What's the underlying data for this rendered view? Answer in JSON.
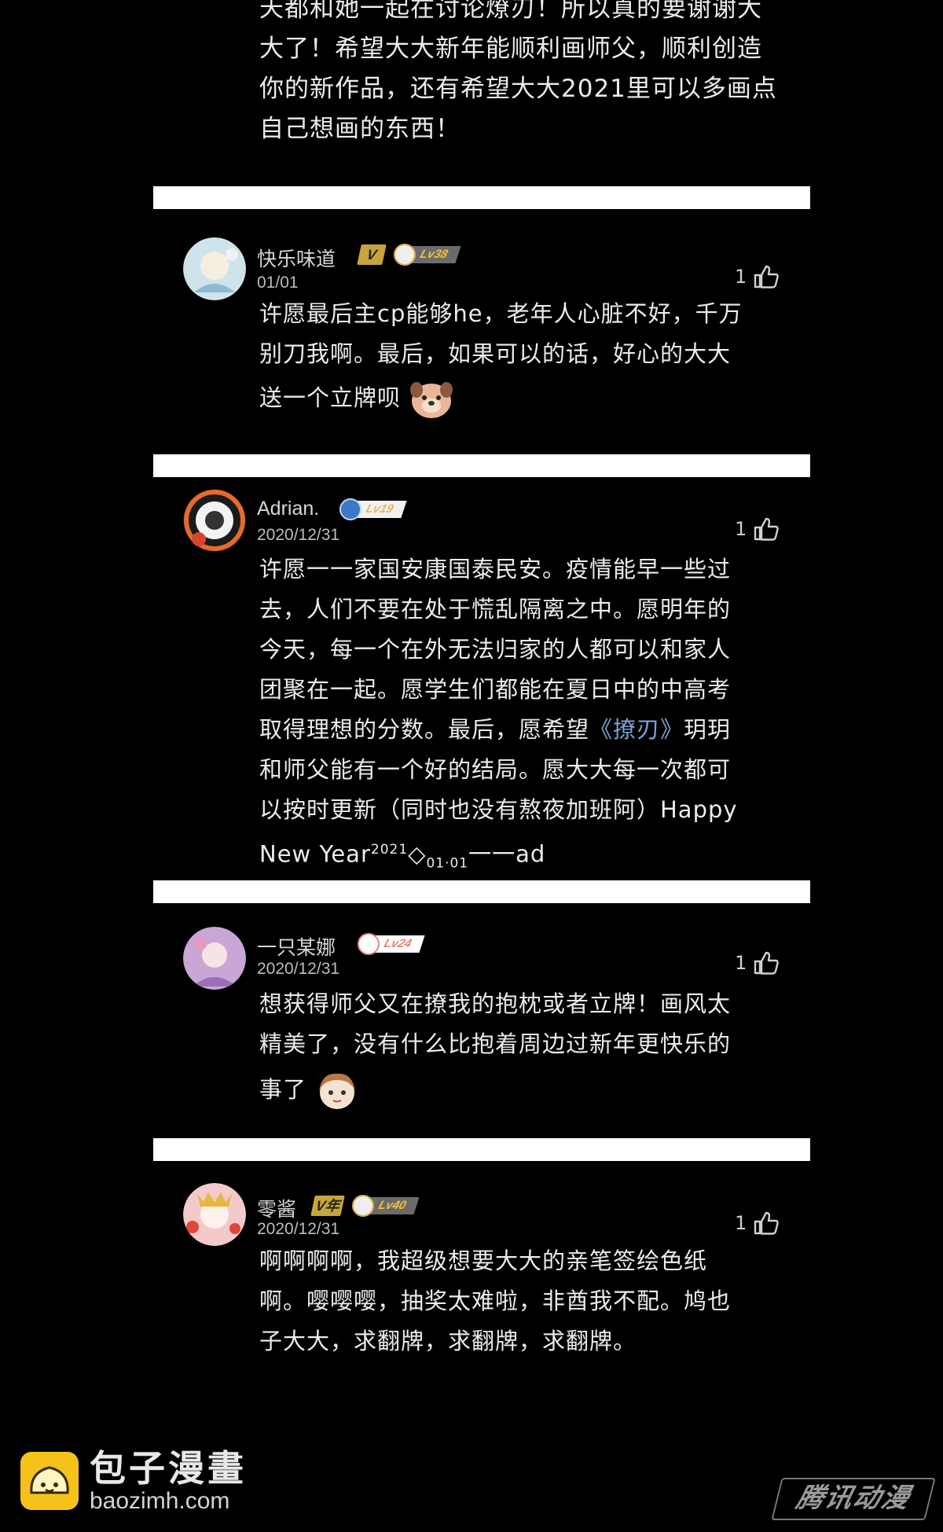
{
  "top_comment": {
    "lines": [
      "天都和她一起在讨论燎刃！所以真的要谢谢大",
      "大了！希望大大新年能顺利画师父，顺利创造",
      "你的新作品，还有希望大大2021里可以多画点",
      "自己想画的东西！"
    ]
  },
  "comments": [
    {
      "username": "快乐味道",
      "vip_badge": "V",
      "level": "Lv38",
      "date": "01/01",
      "likes": "1",
      "lines": [
        "许愿最后主cp能够he，老年人心脏不好，千万",
        "别刀我啊。最后，如果可以的话，好心的大大",
        "送一个立牌呗"
      ]
    },
    {
      "username": "Adrian.",
      "level": "Lv19",
      "date": "2020/12/31",
      "likes": "1",
      "lines": [
        "许愿一一家国安康国泰民安。疫情能早一些过",
        "去，人们不要在处于慌乱隔离之中。愿明年的",
        "今天，每一个在外无法归家的人都可以和家人",
        "团聚在一起。愿学生们都能在夏日中的中高考",
        "和师父能有一个好的结局。愿大大每一次都可",
        "以按时更新（同时也没有熬夜加班阿）Happy"
      ],
      "line5_prefix": "取得理想的分数。最后，愿希望",
      "line5_link": "《撩刃》",
      "line5_suffix": "玥玥",
      "last_line_prefix": "New Year",
      "last_line_sup": "2021",
      "last_line_mid": "◇",
      "last_line_sub": "01·01",
      "last_line_suffix": "一一ad"
    },
    {
      "username": "一只某娜",
      "level": "Lv24",
      "date": "2020/12/31",
      "likes": "1",
      "lines": [
        "想获得师父又在撩我的抱枕或者立牌！画风太",
        "精美了，没有什么比抱着周边过新年更快乐的",
        "事了"
      ]
    },
    {
      "username": "零酱",
      "vip_badge": "V年",
      "level": "Lv40",
      "date": "2020/12/31",
      "likes": "1",
      "lines": [
        "啊啊啊啊，我超级想要大大的亲笔签绘色纸",
        "啊。嘤嘤嘤，抽奖太难啦，非酋我不配。鸠也",
        "子大大，求翻牌，求翻牌，求翻牌。"
      ]
    }
  ],
  "footer": {
    "brand_name": "包子漫畫",
    "brand_url": "baozimh.com",
    "watermark": "腾讯动漫"
  },
  "colors": {
    "background": "#000000",
    "separator": "#ffffff",
    "link": "#7aa3d8",
    "vip_gold": "#c8a53a",
    "logo_yellow": "#f5c21a"
  }
}
